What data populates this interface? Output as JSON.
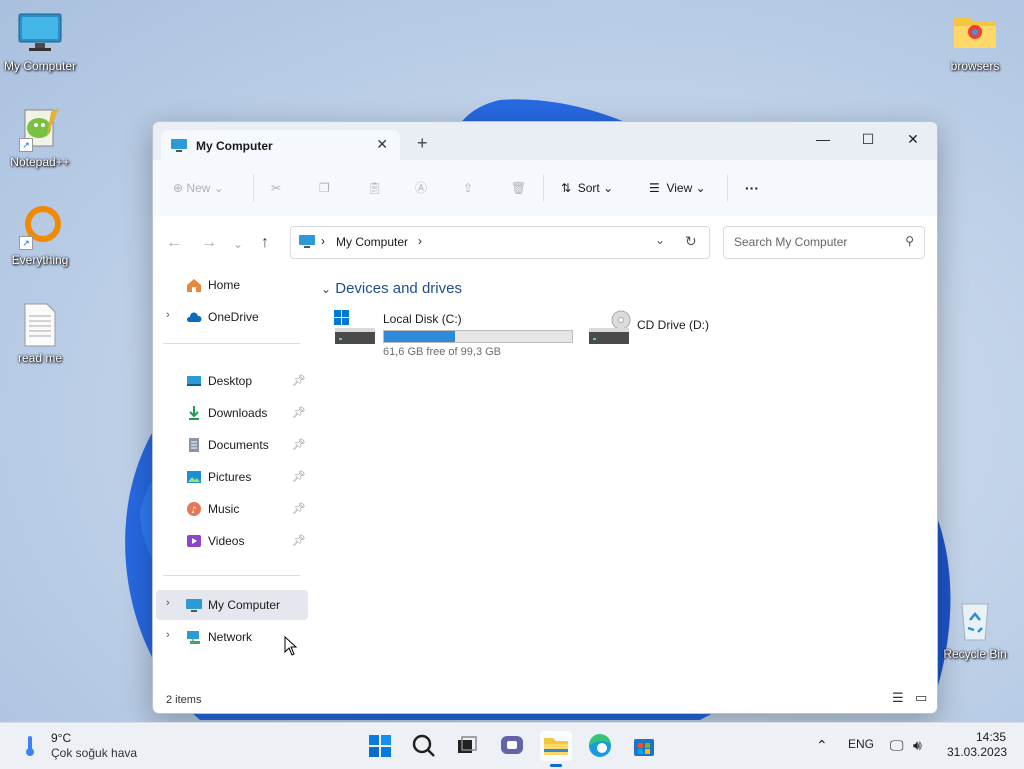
{
  "desktop": {
    "icons": [
      {
        "label": "My Computer"
      },
      {
        "label": "Notepad++"
      },
      {
        "label": "Everything"
      },
      {
        "label": "read me"
      },
      {
        "label": "browsers"
      },
      {
        "label": "Recycle Bin"
      }
    ]
  },
  "window": {
    "tab_title": "My Computer",
    "new_tab_symbol": "+",
    "toolbar": {
      "new_label": "New",
      "sort_label": "Sort",
      "view_label": "View",
      "more_label": "···"
    },
    "address": {
      "path": "My Computer",
      "search_placeholder": "Search My Computer"
    },
    "sidebar": {
      "items": [
        {
          "label": "Home"
        },
        {
          "label": "OneDrive"
        },
        {
          "label": "Desktop"
        },
        {
          "label": "Downloads"
        },
        {
          "label": "Documents"
        },
        {
          "label": "Pictures"
        },
        {
          "label": "Music"
        },
        {
          "label": "Videos"
        },
        {
          "label": "My Computer"
        },
        {
          "label": "Network"
        }
      ]
    },
    "content": {
      "group_title": "Devices and drives",
      "drives": [
        {
          "name": "Local Disk (C:)",
          "free_text": "61,6 GB free of 99,3 GB",
          "used_fraction": 0.38
        },
        {
          "name": "CD Drive (D:)"
        }
      ]
    },
    "status": {
      "item_count": "2 items"
    }
  },
  "taskbar": {
    "weather": {
      "temp": "9°C",
      "desc": "Çok soğuk hava"
    },
    "language": "ENG",
    "time": "14:35",
    "date": "31.03.2023"
  },
  "colors": {
    "accent": "#2f8bd8",
    "selection": "#e4e8ee",
    "group_header": "#1f4e8c"
  }
}
